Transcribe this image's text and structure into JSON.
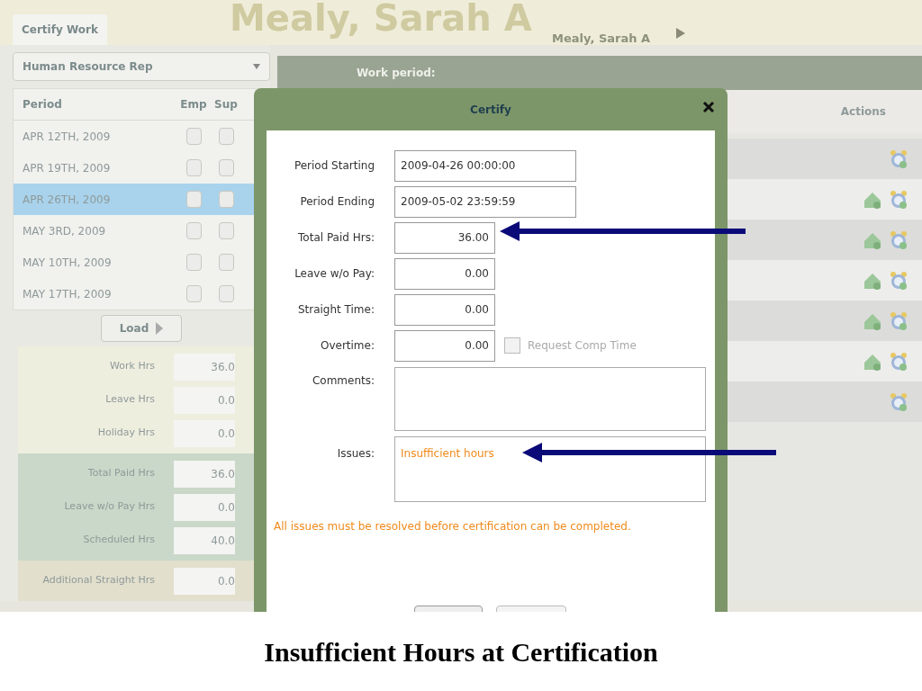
{
  "slide_title": "Insufficient Hours at Certification",
  "tabs": [
    {
      "label": "Certify Work",
      "selected": true
    }
  ],
  "employee": {
    "name_large": "Mealy, Sarah A",
    "name": "Mealy, Sarah A"
  },
  "role_select": {
    "value": "Human Resource Rep"
  },
  "periods": {
    "columns": [
      "Period",
      "Emp",
      "Sup"
    ],
    "rows": [
      {
        "period": "APR 12TH, 2009",
        "emp": false,
        "sup": false,
        "selected": false
      },
      {
        "period": "APR 19TH, 2009",
        "emp": false,
        "sup": false,
        "selected": false
      },
      {
        "period": "APR 26TH, 2009",
        "emp": false,
        "sup": false,
        "selected": true
      },
      {
        "period": "MAY 3RD, 2009",
        "emp": false,
        "sup": false,
        "selected": false
      },
      {
        "period": "MAY 10TH, 2009",
        "emp": false,
        "sup": false,
        "selected": false
      },
      {
        "period": "MAY 17TH, 2009",
        "emp": false,
        "sup": false,
        "selected": false
      }
    ]
  },
  "load_button": "Load",
  "summary": [
    {
      "color": "#eeeedf",
      "rows": [
        {
          "label": "Work Hrs",
          "value": "36.0"
        },
        {
          "label": "Leave Hrs",
          "value": "0.0"
        },
        {
          "label": "Holiday Hrs",
          "value": "0.0"
        }
      ]
    },
    {
      "color": "#c9d8c8",
      "rows": [
        {
          "label": "Total Paid Hrs",
          "value": "36.0"
        },
        {
          "label": "Leave w/o Pay Hrs",
          "value": "0.0"
        },
        {
          "label": "Scheduled Hrs",
          "value": "40.0"
        }
      ]
    },
    {
      "color": "#e2dfcc",
      "rows": [
        {
          "label": "Additional Straight Hrs",
          "value": "0.0"
        }
      ]
    }
  ],
  "work_period": {
    "title": "Work period:",
    "actions_header": "Actions",
    "rows": [
      {
        "leave_icon": false
      },
      {
        "leave_icon": true
      },
      {
        "leave_icon": true
      },
      {
        "leave_icon": true
      },
      {
        "leave_icon": true
      },
      {
        "leave_icon": true
      },
      {
        "leave_icon": false
      }
    ]
  },
  "dialog": {
    "title": "Certify",
    "fields": [
      {
        "label": "Period Starting",
        "value": "2009-04-26 00:00:00",
        "kind": "wide"
      },
      {
        "label": "Period Ending",
        "value": "2009-05-02 23:59:59",
        "kind": "wide"
      },
      {
        "label": "Total Paid Hrs:",
        "value": "36.00",
        "kind": "number"
      },
      {
        "label": "Leave w/o Pay:",
        "value": "0.00",
        "kind": "number"
      },
      {
        "label": "Straight Time:",
        "value": "0.00",
        "kind": "number"
      },
      {
        "label": "Overtime:",
        "value": "0.00",
        "kind": "number",
        "option": {
          "label": "Request Comp Time",
          "checked": false,
          "disabled": true
        }
      }
    ],
    "comments": {
      "label": "Comments:"
    },
    "issues": {
      "label": "Issues:",
      "value": "Insufficient hours"
    },
    "message": "All issues must be resolved before certification can be completed."
  }
}
